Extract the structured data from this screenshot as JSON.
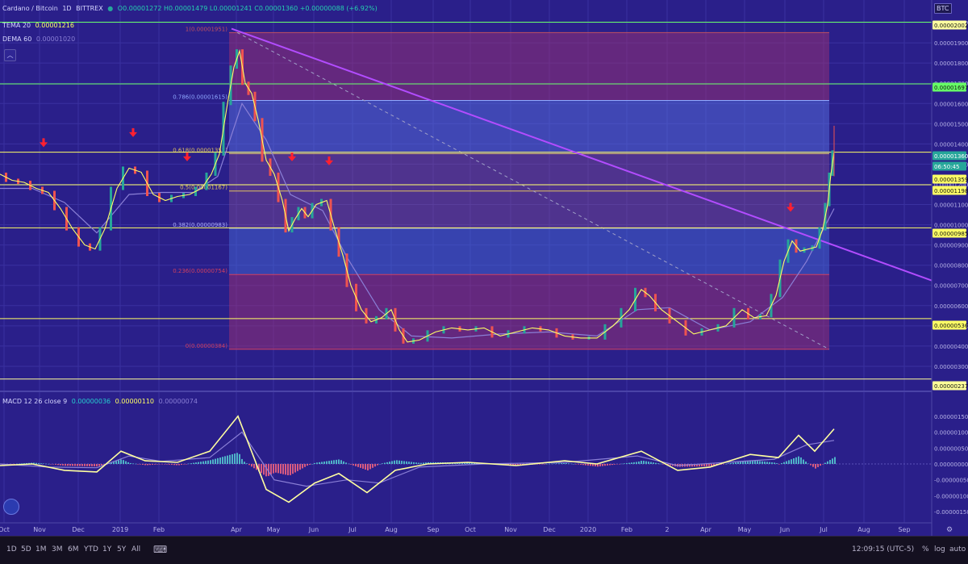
{
  "header": {
    "symbol": "Cardano / Bitcoin",
    "interval": "1D",
    "exchange": "BITTREX",
    "ohlc": "O0.00001272 H0.00001479 L0.00001241 C0.00001360 +0.00000088 (+6.92%)",
    "indicators": [
      {
        "name": "TEMA 20",
        "value": "0.00001216",
        "color": "#ffff66"
      },
      {
        "name": "DEMA 60",
        "value": "0.00001020",
        "color": "#8a7fd6"
      }
    ],
    "macd": {
      "name": "MACD 12 26 close 9",
      "v1": "0.00000036",
      "v2": "0.00000110",
      "v3": "0.00000074"
    }
  },
  "price_axis": {
    "currency": "BTC",
    "ticks": [
      "0.00002000",
      "0.00001900",
      "0.00001800",
      "0.00001700",
      "0.00001600",
      "0.00001500",
      "0.00001400",
      "0.00001300",
      "0.00001200",
      "0.00001100",
      "0.00001000",
      "0.00000900",
      "0.00000800",
      "0.00000700",
      "0.00000600",
      "0.00000500",
      "0.00000400",
      "0.00000300"
    ],
    "labels": [
      {
        "text": "0.00002002",
        "bg": "#ffffa0",
        "fg": "#111111"
      },
      {
        "text": "0.00001697",
        "bg": "#66ff66",
        "fg": "#111111"
      },
      {
        "text": "0.00001360",
        "bg": "#26a69a",
        "fg": "#ffffff"
      },
      {
        "text": "06:50:45",
        "bg": "#26a69a",
        "fg": "#ffffff"
      },
      {
        "text": "0.00001359",
        "bg": "#ffff66",
        "fg": "#111111"
      },
      {
        "text": "0.00001198",
        "bg": "#ffff66",
        "fg": "#111111"
      },
      {
        "text": "0.00000985",
        "bg": "#ffff66",
        "fg": "#111111"
      },
      {
        "text": "0.00000536",
        "bg": "#ffff66",
        "fg": "#111111"
      },
      {
        "text": "0.00000237",
        "bg": "#ffff99",
        "fg": "#111111"
      }
    ]
  },
  "macd_axis": {
    "ticks": [
      "0.00000150",
      "0.00000100",
      "0.00000050",
      "0.00000000",
      "-0.00000050",
      "-0.00000100",
      "-0.00000150"
    ]
  },
  "fib_levels": [
    {
      "label": "1(0.00001951)",
      "price": 1.951e-05,
      "color": "#c05060"
    },
    {
      "label": "0.786(0.00001615)",
      "price": 1.615e-05,
      "color": "#8fa8ff"
    },
    {
      "label": "0.618(0.00001352)",
      "price": 1.352e-05,
      "color": "#e0c060"
    },
    {
      "label": "0.5(0.00001167)",
      "price": 1.167e-05,
      "color": "#e0c060"
    },
    {
      "label": "0.382(0.00000983)",
      "price": 9.83e-06,
      "color": "#b0b0ff"
    },
    {
      "label": "0.236(0.00000754)",
      "price": 7.54e-06,
      "color": "#d04060"
    },
    {
      "label": "0(0.00000384)",
      "price": 3.84e-06,
      "color": "#d04060"
    }
  ],
  "time_axis": {
    "labels": [
      "Oct",
      "Nov",
      "Dec",
      "2019",
      "Feb",
      "Apr",
      "May",
      "Jun",
      "Jul",
      "Aug",
      "Sep",
      "Oct",
      "Nov",
      "Dec",
      "2020",
      "Feb",
      "2",
      "Apr",
      "May",
      "Jun",
      "Jul",
      "Aug",
      "Sep"
    ]
  },
  "bottom_bar": {
    "ranges": [
      "1D",
      "5D",
      "1M",
      "3M",
      "6M",
      "YTD",
      "1Y",
      "5Y",
      "All"
    ],
    "time": "12:09:15 (UTC-5)",
    "options": [
      "%",
      "log",
      "auto"
    ]
  },
  "chart_data": {
    "type": "line",
    "x_range": [
      "2018-10",
      "2020-09"
    ],
    "ylim": [
      2.2e-06,
      2.08e-05
    ],
    "series": [
      {
        "values": [
          [
            0,
            1.25e-05
          ],
          [
            15,
            1.22e-05
          ],
          [
            30,
            1.21e-05
          ],
          [
            45,
            1.18e-05
          ],
          [
            60,
            1.16e-05
          ],
          [
            75,
            1.08e-05
          ],
          [
            90,
            9.8e-06
          ],
          [
            105,
            9e-06
          ],
          [
            118,
            8.8e-06
          ],
          [
            130,
            9.8e-06
          ],
          [
            145,
            1.18e-05
          ],
          [
            160,
            1.28e-05
          ],
          [
            175,
            1.26e-05
          ],
          [
            190,
            1.15e-05
          ],
          [
            205,
            1.12e-05
          ],
          [
            220,
            1.14e-05
          ],
          [
            235,
            1.15e-05
          ],
          [
            250,
            1.18e-05
          ],
          [
            262,
            1.25e-05
          ],
          [
            272,
            1.35e-05
          ],
          [
            282,
            1.6e-05
          ],
          [
            290,
            1.78e-05
          ],
          [
            297,
            1.86e-05
          ],
          [
            304,
            1.7e-05
          ],
          [
            312,
            1.65e-05
          ],
          [
            320,
            1.52e-05
          ],
          [
            330,
            1.32e-05
          ],
          [
            340,
            1.25e-05
          ],
          [
            350,
            1.12e-05
          ],
          [
            358,
            9.7e-06
          ],
          [
            366,
            1.03e-05
          ],
          [
            374,
            1.08e-05
          ],
          [
            382,
            1.04e-05
          ],
          [
            392,
            1.1e-05
          ],
          [
            405,
            1.12e-05
          ],
          [
            415,
            9.8e-06
          ],
          [
            425,
            8.5e-06
          ],
          [
            435,
            7e-06
          ],
          [
            448,
            5.8e-06
          ],
          [
            460,
            5.2e-06
          ],
          [
            473,
            5.4e-06
          ],
          [
            485,
            5.8e-06
          ],
          [
            495,
            4.8e-06
          ],
          [
            505,
            4.2e-06
          ],
          [
            520,
            4.3e-06
          ],
          [
            540,
            4.7e-06
          ],
          [
            560,
            4.9e-06
          ],
          [
            580,
            4.8e-06
          ],
          [
            600,
            4.9e-06
          ],
          [
            620,
            4.5e-06
          ],
          [
            640,
            4.7e-06
          ],
          [
            660,
            4.9e-06
          ],
          [
            680,
            4.8e-06
          ],
          [
            700,
            4.5e-06
          ],
          [
            720,
            4.4e-06
          ],
          [
            740,
            4.4e-06
          ],
          [
            760,
            5e-06
          ],
          [
            780,
            5.8e-06
          ],
          [
            795,
            6.8e-06
          ],
          [
            805,
            6.5e-06
          ],
          [
            820,
            5.8e-06
          ],
          [
            840,
            5.2e-06
          ],
          [
            860,
            4.6e-06
          ],
          [
            880,
            4.8e-06
          ],
          [
            900,
            5e-06
          ],
          [
            920,
            5.8e-06
          ],
          [
            935,
            5.4e-06
          ],
          [
            950,
            5.5e-06
          ],
          [
            962,
            6.5e-06
          ],
          [
            972,
            8.2e-06
          ],
          [
            982,
            9.2e-06
          ],
          [
            992,
            8.7e-06
          ],
          [
            1002,
            8.8e-06
          ],
          [
            1012,
            8.9e-06
          ],
          [
            1020,
            9.8e-06
          ],
          [
            1026,
            1.1e-05
          ],
          [
            1030,
            1.25e-05
          ],
          [
            1034,
            1.36e-05
          ]
        ]
      },
      {
        "values": [
          [
            0,
            1.18e-05
          ],
          [
            40,
            1.18e-05
          ],
          [
            80,
            1.11e-05
          ],
          [
            120,
            9.6e-06
          ],
          [
            160,
            1.15e-05
          ],
          [
            200,
            1.16e-05
          ],
          [
            240,
            1.16e-05
          ],
          [
            270,
            1.24e-05
          ],
          [
            300,
            1.6e-05
          ],
          [
            330,
            1.42e-05
          ],
          [
            360,
            1.15e-05
          ],
          [
            400,
            1.07e-05
          ],
          [
            430,
            8.4e-06
          ],
          [
            470,
            5.8e-06
          ],
          [
            510,
            4.5e-06
          ],
          [
            560,
            4.4e-06
          ],
          [
            620,
            4.6e-06
          ],
          [
            680,
            4.7e-06
          ],
          [
            740,
            4.5e-06
          ],
          [
            790,
            5.8e-06
          ],
          [
            830,
            5.9e-06
          ],
          [
            880,
            4.8e-06
          ],
          [
            930,
            5.2e-06
          ],
          [
            970,
            6.4e-06
          ],
          [
            1000,
            8.2e-06
          ],
          [
            1034,
            1.08e-05
          ]
        ]
      }
    ],
    "macd": [
      [
        0,
        -5e-08
      ],
      [
        40,
        0.0
      ],
      [
        80,
        -2e-07
      ],
      [
        120,
        -2.5e-07
      ],
      [
        150,
        4e-07
      ],
      [
        180,
        1e-07
      ],
      [
        220,
        5e-08
      ],
      [
        260,
        4e-07
      ],
      [
        295,
        1.5e-06
      ],
      [
        330,
        -8e-07
      ],
      [
        358,
        -1.2e-06
      ],
      [
        390,
        -6e-07
      ],
      [
        420,
        -3e-07
      ],
      [
        455,
        -9e-07
      ],
      [
        490,
        -2e-07
      ],
      [
        530,
        0.0
      ],
      [
        580,
        5e-08
      ],
      [
        640,
        -5e-08
      ],
      [
        700,
        1e-07
      ],
      [
        740,
        0.0
      ],
      [
        795,
        4e-07
      ],
      [
        840,
        -2e-07
      ],
      [
        880,
        -1e-07
      ],
      [
        930,
        3e-07
      ],
      [
        965,
        2e-07
      ],
      [
        990,
        9e-07
      ],
      [
        1010,
        4e-07
      ],
      [
        1034,
        1.1e-06
      ]
    ],
    "macd_signal": [
      [
        0,
        0.0
      ],
      [
        60,
        -1e-07
      ],
      [
        120,
        -1.2e-07
      ],
      [
        160,
        2.5e-07
      ],
      [
        200,
        8e-08
      ],
      [
        260,
        2e-07
      ],
      [
        300,
        1e-06
      ],
      [
        340,
        -5e-07
      ],
      [
        380,
        -7e-07
      ],
      [
        430,
        -5e-07
      ],
      [
        470,
        -6e-07
      ],
      [
        520,
        -1e-07
      ],
      [
        600,
        0.0
      ],
      [
        700,
        5e-08
      ],
      [
        790,
        2.5e-07
      ],
      [
        840,
        -5e-08
      ],
      [
        900,
        5e-08
      ],
      [
        960,
        1.5e-07
      ],
      [
        1000,
        6e-07
      ],
      [
        1034,
        7.4e-07
      ]
    ],
    "arrows": [
      [
        54,
        1.4e-05
      ],
      [
        165,
        1.45e-05
      ],
      [
        232,
        1.33e-05
      ],
      [
        362,
        1.33e-05
      ],
      [
        408,
        1.31e-05
      ],
      [
        980,
        1.08e-05
      ]
    ],
    "trendline": {
      "start": [
        287,
        1.97e-05
      ],
      "end": [
        1200,
        6.6e-06
      ],
      "color": "#b24cff"
    },
    "fib_box": {
      "x1": 284,
      "x2": 1028
    },
    "hlines": [
      {
        "price": 2.002e-05,
        "color": "#66ff66"
      },
      {
        "price": 1.697e-05,
        "color": "#66ff66"
      },
      {
        "price": 1.359e-05,
        "color": "#ffff66"
      },
      {
        "price": 1.198e-05,
        "color": "#ffff66"
      },
      {
        "price": 9.85e-06,
        "color": "#ffff66"
      },
      {
        "price": 5.36e-06,
        "color": "#ffff66"
      },
      {
        "price": 2.37e-06,
        "color": "#ffff99"
      }
    ]
  }
}
